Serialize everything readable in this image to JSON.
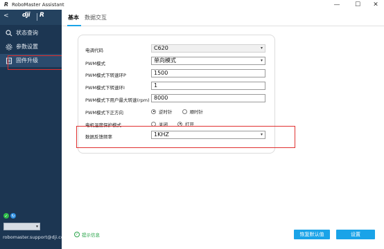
{
  "window": {
    "logo": "R",
    "title": "RoboMaster Assistant",
    "min": "—",
    "max": "☐",
    "close": "✕"
  },
  "sidebar": {
    "back": "<",
    "brand": "dji",
    "brand_r": "R",
    "items": [
      {
        "label": "状态查询",
        "icon": "status-icon"
      },
      {
        "label": "参数设置",
        "icon": "gear-icon"
      },
      {
        "label": "固件升级",
        "icon": "firmware-icon"
      }
    ],
    "active_index": 2,
    "email": "robomaster.support@dji.com"
  },
  "tabs": [
    {
      "label": "基本"
    },
    {
      "label": "数据交互"
    }
  ],
  "active_tab": 0,
  "form": {
    "esc_code": {
      "label": "电调代码",
      "value": "C620"
    },
    "pwm_mode": {
      "label": "PWM模式",
      "value": "单向模式"
    },
    "pwm_p": {
      "label": "PWM模式下转速环P",
      "value": "1500"
    },
    "pwm_i": {
      "label": "PWM模式下转速环I",
      "value": "1"
    },
    "pwm_max_speed": {
      "label": "PWM模式下用户最大转速(rpm)",
      "value": "8000"
    },
    "pwm_direction": {
      "label": "PWM模式下正方向",
      "options": [
        "逆时针",
        "顺时针"
      ],
      "selected": 0
    },
    "temp_protect": {
      "label": "电机温度保护模式",
      "options": [
        "关闭",
        "打开"
      ],
      "selected": 1
    },
    "feedback_freq": {
      "label": "数据反馈频率",
      "value": "1KHZ"
    }
  },
  "footer": {
    "hint": "提示信息",
    "reset_label": "恢复默认值",
    "set_label": "设置"
  },
  "colors": {
    "sidebar": "#1c3652",
    "accent": "#1aa3e8",
    "highlight": "#e0302f",
    "ok": "#2aa44a"
  }
}
